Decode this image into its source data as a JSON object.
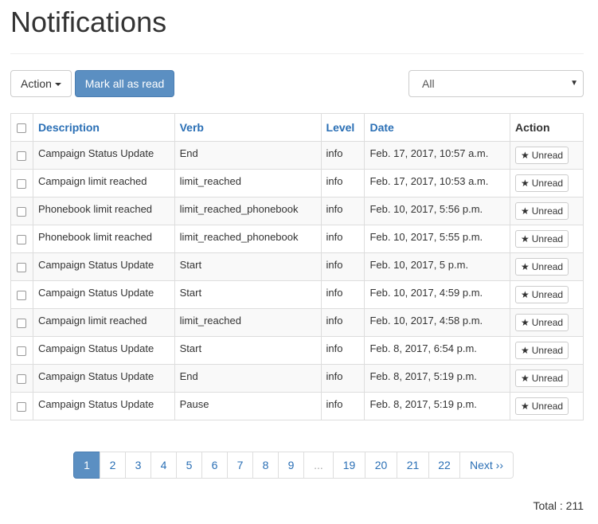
{
  "page_title": "Notifications",
  "toolbar": {
    "action_label": "Action",
    "mark_all_label": "Mark all as read"
  },
  "filter": {
    "selected": "All"
  },
  "table": {
    "headers": {
      "description": "Description",
      "verb": "Verb",
      "level": "Level",
      "date": "Date",
      "action": "Action"
    },
    "unread_label": "Unread",
    "rows": [
      {
        "description": "Campaign Status Update",
        "verb": "End",
        "level": "info",
        "date": "Feb. 17, 2017, 10:57 a.m."
      },
      {
        "description": "Campaign limit reached",
        "verb": "limit_reached",
        "level": "info",
        "date": "Feb. 17, 2017, 10:53 a.m."
      },
      {
        "description": "Phonebook limit reached",
        "verb": "limit_reached_phonebook",
        "level": "info",
        "date": "Feb. 10, 2017, 5:56 p.m."
      },
      {
        "description": "Phonebook limit reached",
        "verb": "limit_reached_phonebook",
        "level": "info",
        "date": "Feb. 10, 2017, 5:55 p.m."
      },
      {
        "description": "Campaign Status Update",
        "verb": "Start",
        "level": "info",
        "date": "Feb. 10, 2017, 5 p.m."
      },
      {
        "description": "Campaign Status Update",
        "verb": "Start",
        "level": "info",
        "date": "Feb. 10, 2017, 4:59 p.m."
      },
      {
        "description": "Campaign limit reached",
        "verb": "limit_reached",
        "level": "info",
        "date": "Feb. 10, 2017, 4:58 p.m."
      },
      {
        "description": "Campaign Status Update",
        "verb": "Start",
        "level": "info",
        "date": "Feb. 8, 2017, 6:54 p.m."
      },
      {
        "description": "Campaign Status Update",
        "verb": "End",
        "level": "info",
        "date": "Feb. 8, 2017, 5:19 p.m."
      },
      {
        "description": "Campaign Status Update",
        "verb": "Pause",
        "level": "info",
        "date": "Feb. 8, 2017, 5:19 p.m."
      }
    ]
  },
  "pagination": {
    "pages": [
      "1",
      "2",
      "3",
      "4",
      "5",
      "6",
      "7",
      "8",
      "9",
      "...",
      "19",
      "20",
      "21",
      "22",
      "Next ››"
    ],
    "active": "1"
  },
  "total": "Total : 211"
}
